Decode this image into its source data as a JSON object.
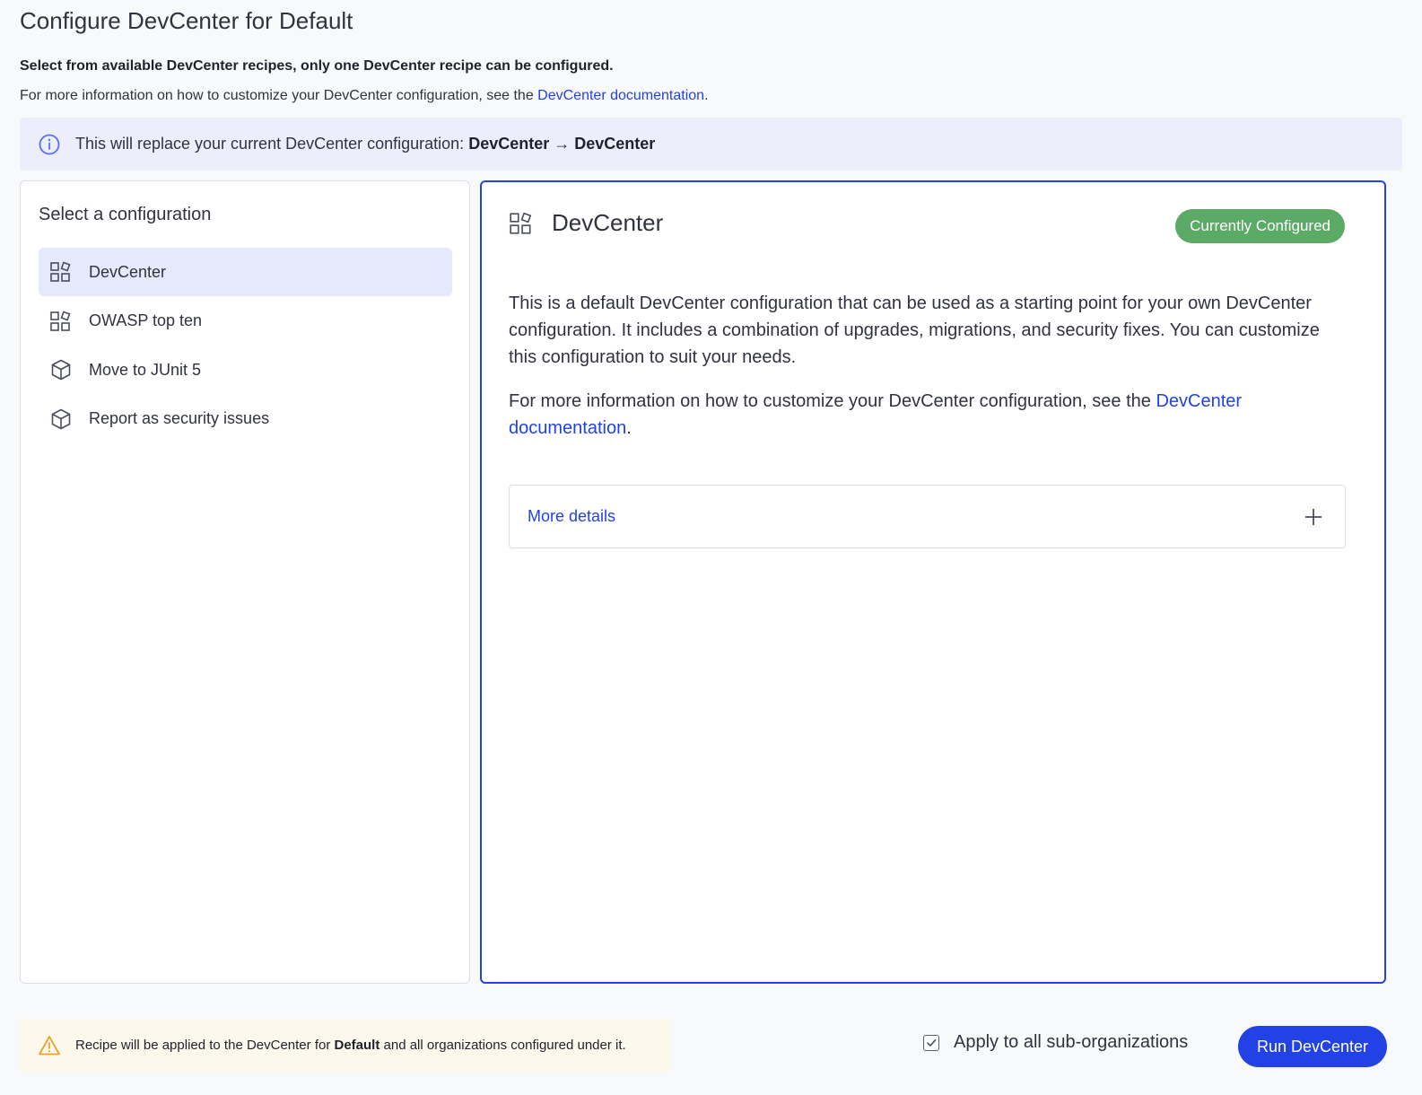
{
  "page": {
    "title": "Configure DevCenter for Default",
    "intro_bold": "Select from available DevCenter recipes, only one DevCenter recipe can be configured.",
    "intro_prefix": "For more information on how to customize your DevCenter configuration, see the ",
    "intro_link": "DevCenter documentation",
    "intro_suffix": "."
  },
  "banner": {
    "icon": "info-icon",
    "text": "This will replace your current DevCenter configuration: ",
    "transition": "DevCenter → DevCenter"
  },
  "left_panel": {
    "heading": "Select a configuration",
    "items": [
      {
        "label": "DevCenter",
        "icon": "grid-shapes-icon",
        "selected": true
      },
      {
        "label": "OWASP top ten",
        "icon": "grid-shapes-icon",
        "selected": false
      },
      {
        "label": "Move to JUnit 5",
        "icon": "cube-icon",
        "selected": false
      },
      {
        "label": "Report as security issues",
        "icon": "cube-icon",
        "selected": false
      }
    ]
  },
  "detail": {
    "icon": "grid-shapes-icon",
    "title": "DevCenter",
    "badge": "Currently Configured",
    "badge_color": "#5bab67",
    "paragraph1": "This is a default DevCenter configuration that can be used as a starting point for your own DevCenter configuration. It includes a combination of upgrades, migrations, and security fixes. You can customize this configuration to suit your needs.",
    "paragraph2_prefix": "For more information on how to customize your DevCenter configuration, see the ",
    "paragraph2_link": "DevCenter documentation",
    "paragraph2_suffix": ".",
    "more_details": "More details"
  },
  "footer": {
    "warning_icon": "warning-icon",
    "warning_prefix": "Recipe will be applied to the DevCenter for ",
    "warning_org": "Default",
    "warning_suffix": " and all organizations configured under it.",
    "apply_label": "Apply to all sub-organizations",
    "apply_checked": true,
    "run_button": "Run DevCenter"
  },
  "colors": {
    "accent": "#2242e6",
    "selected_bg": "#e6e9fb",
    "info_bg": "#eceefb",
    "warning_bg": "#fdf8ec",
    "success": "#5bab67"
  }
}
